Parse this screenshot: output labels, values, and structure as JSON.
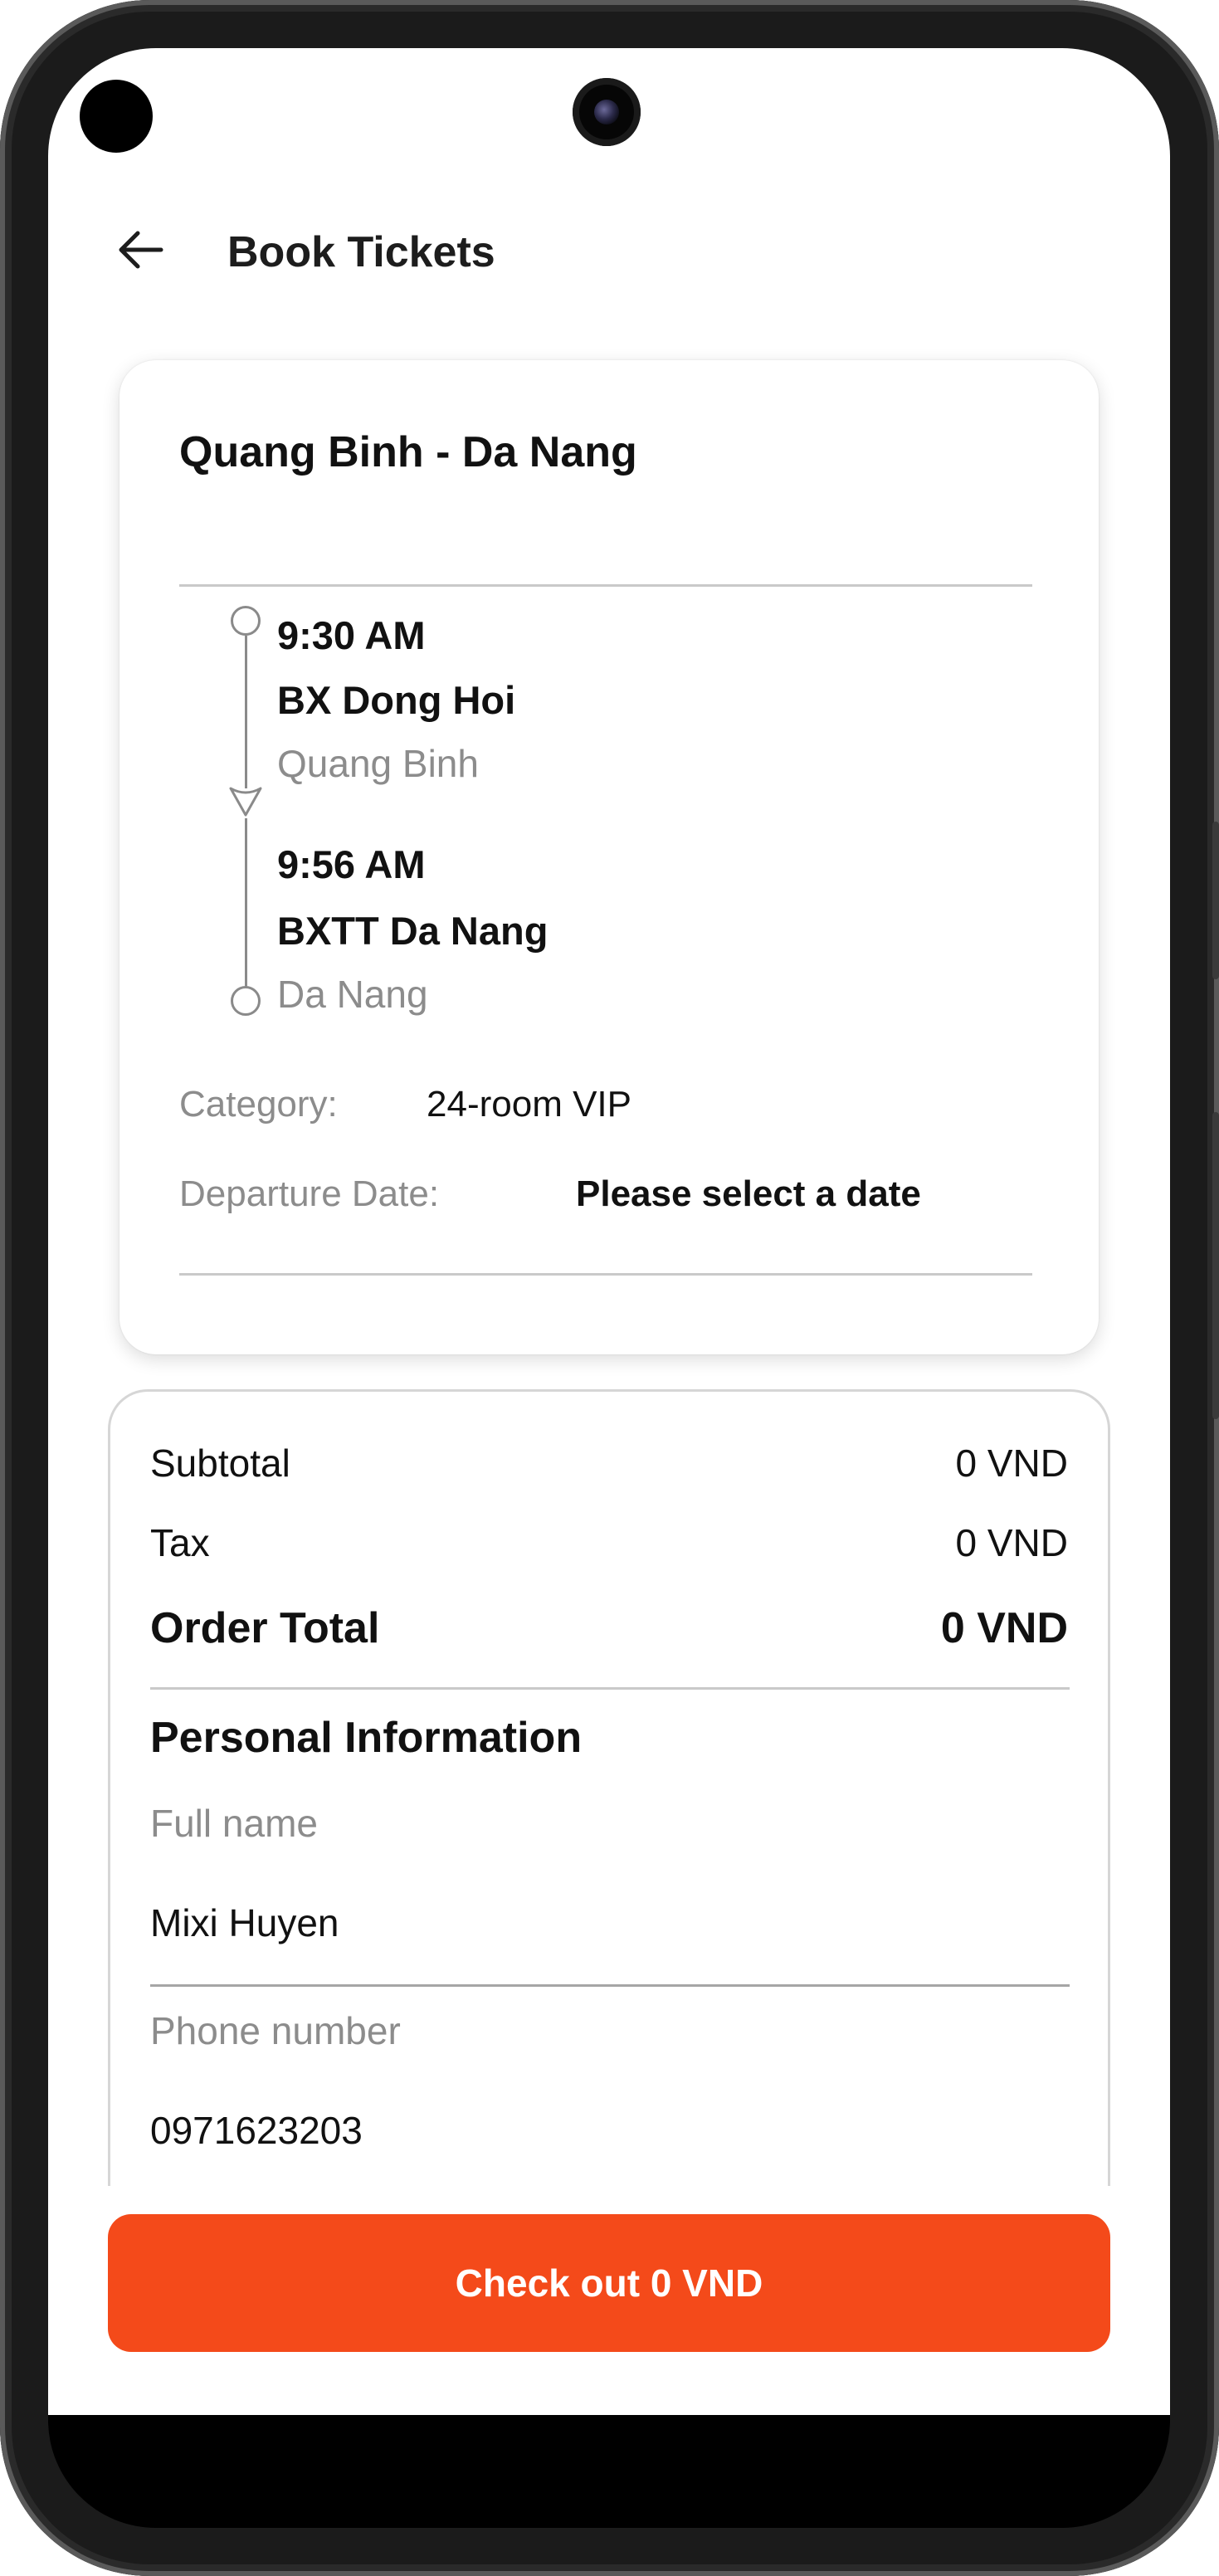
{
  "header": {
    "title": "Book Tickets",
    "back_icon": "arrow-left-icon"
  },
  "route": {
    "title": "Quang Binh - Da Nang",
    "departure": {
      "time": "9:30 AM",
      "station": "BX Dong Hoi",
      "city": "Quang Binh"
    },
    "arrival": {
      "time": "9:56 AM",
      "station": "BXTT Da Nang",
      "city": "Da Nang"
    },
    "category_label": "Category:",
    "category_value": "24-room VIP",
    "date_label": "Departure Date:",
    "date_value": "Please select a date"
  },
  "order": {
    "subtotal_label": "Subtotal",
    "subtotal_value": "0 VND",
    "tax_label": "Tax",
    "tax_value": "0 VND",
    "total_label": "Order Total",
    "total_value": "0 VND"
  },
  "personal": {
    "title": "Personal Information",
    "name_label": "Full name",
    "name_value": "Mixi Huyen",
    "phone_label": "Phone number",
    "phone_value": "0971623203"
  },
  "checkout": {
    "label": "Check out 0 VND",
    "color": "#f44a1a"
  },
  "navbar": {
    "icons": [
      "back-triangle-icon",
      "home-circle-icon",
      "recents-square-icon"
    ]
  }
}
